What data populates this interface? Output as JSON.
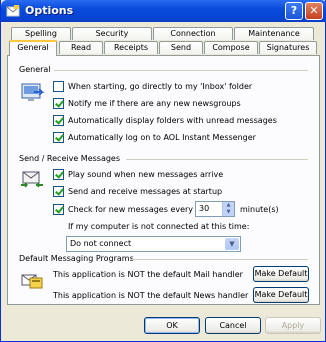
{
  "window": {
    "title": "Options"
  },
  "tabs_back": [
    "Spelling",
    "Security",
    "Connection",
    "Maintenance"
  ],
  "tabs_front": [
    "General",
    "Read",
    "Receipts",
    "Send",
    "Compose",
    "Signatures"
  ],
  "general": {
    "heading": "General",
    "items": [
      {
        "label": "When starting, go directly to my 'Inbox' folder",
        "checked": false
      },
      {
        "label": "Notify me if there are any new newsgroups",
        "checked": true
      },
      {
        "label": "Automatically display folders with unread messages",
        "checked": true
      },
      {
        "label": "Automatically log on to AOL Instant Messenger",
        "checked": true
      }
    ]
  },
  "send_receive": {
    "heading": "Send / Receive Messages",
    "play_sound": {
      "label": "Play sound when new messages arrive",
      "checked": true
    },
    "send_startup": {
      "label": "Send and receive messages at startup",
      "checked": true
    },
    "check_new": {
      "label": "Check for new messages every",
      "checked": true,
      "value": "30",
      "unit": "minute(s)"
    },
    "not_connected_label": "If my computer is not connected at this time:",
    "not_connected_value": "Do not connect"
  },
  "default_programs": {
    "heading": "Default Messaging Programs",
    "mail_text": "This application is NOT the default Mail handler",
    "news_text": "This application is NOT the default News handler",
    "make_default": "Make Default"
  },
  "buttons": {
    "ok": "OK",
    "cancel": "Cancel",
    "apply": "Apply"
  }
}
